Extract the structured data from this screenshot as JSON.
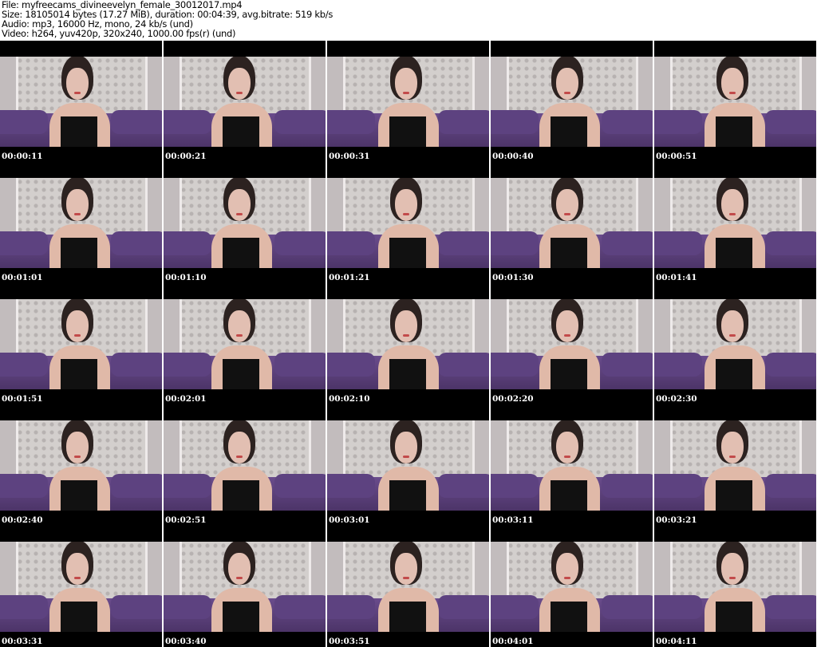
{
  "header": {
    "file": "File: myfreecams_divineevelyn_female_30012017.mp4",
    "size": "Size: 18105014 bytes (17.27 MiB), duration: 00:04:39, avg.bitrate: 519 kb/s",
    "audio": "Audio: mp3, 16000 Hz, mono, 24 kb/s (und)",
    "video": "Video: h264, yuv420p, 320x240, 1000.00 fps(r) (und)"
  },
  "thumbnails": [
    "00:00:11",
    "00:00:21",
    "00:00:31",
    "00:00:40",
    "00:00:51",
    "00:01:01",
    "00:01:10",
    "00:01:21",
    "00:01:30",
    "00:01:41",
    "00:01:51",
    "00:02:01",
    "00:02:10",
    "00:02:20",
    "00:02:30",
    "00:02:40",
    "00:02:51",
    "00:03:01",
    "00:03:11",
    "00:03:21",
    "00:03:31",
    "00:03:40",
    "00:03:51",
    "00:04:01",
    "00:04:11"
  ]
}
